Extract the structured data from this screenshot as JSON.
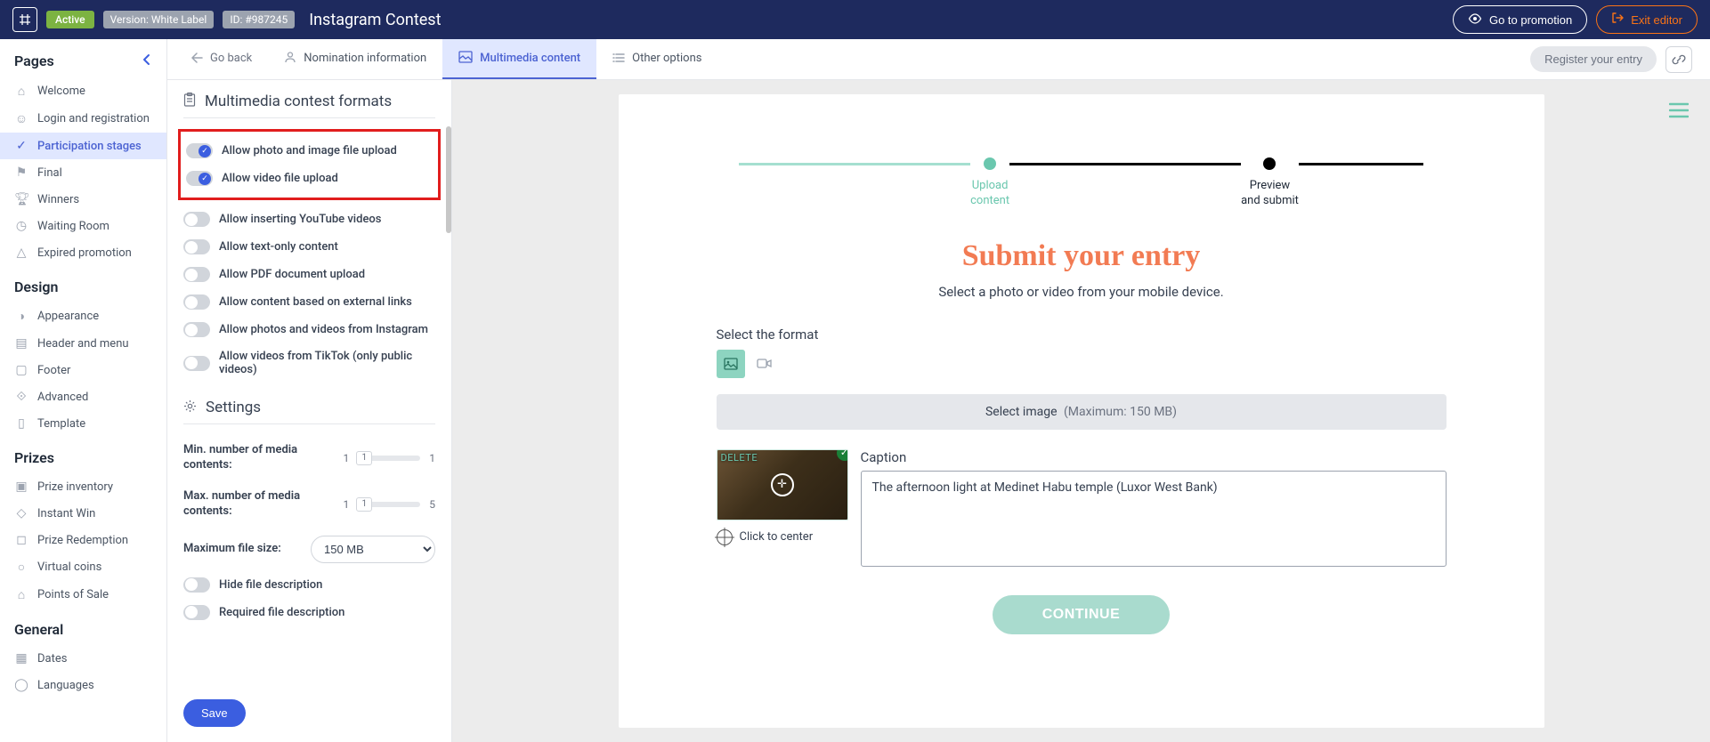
{
  "topbar": {
    "active_badge": "Active",
    "version_prefix": "Version: ",
    "version_value": "White Label",
    "id_prefix": "ID: ",
    "id_value": "#987245",
    "title": "Instagram Contest",
    "goto_label": "Go to promotion",
    "exit_label": "Exit editor"
  },
  "sidebar": {
    "pages_title": "Pages",
    "pages": [
      {
        "label": "Welcome"
      },
      {
        "label": "Login and registration"
      },
      {
        "label": "Participation stages"
      },
      {
        "label": "Final"
      },
      {
        "label": "Winners"
      },
      {
        "label": "Waiting Room"
      },
      {
        "label": "Expired promotion"
      }
    ],
    "design_title": "Design",
    "design": [
      {
        "label": "Appearance"
      },
      {
        "label": "Header and menu"
      },
      {
        "label": "Footer"
      },
      {
        "label": "Advanced"
      },
      {
        "label": "Template"
      }
    ],
    "prizes_title": "Prizes",
    "prizes": [
      {
        "label": "Prize inventory"
      },
      {
        "label": "Instant Win"
      },
      {
        "label": "Prize Redemption"
      },
      {
        "label": "Virtual coins"
      },
      {
        "label": "Points of Sale"
      }
    ],
    "general_title": "General",
    "general": [
      {
        "label": "Dates"
      },
      {
        "label": "Languages"
      }
    ]
  },
  "tabs": {
    "go_back": "Go back",
    "nomination": "Nomination information",
    "multimedia": "Multimedia content",
    "other": "Other options",
    "register": "Register your entry"
  },
  "panel": {
    "formats_heading": "Multimedia contest formats",
    "settings_heading": "Settings",
    "toggles": [
      {
        "label": "Allow photo and image file upload",
        "on": true
      },
      {
        "label": "Allow video file upload",
        "on": true
      },
      {
        "label": "Allow inserting YouTube videos",
        "on": false
      },
      {
        "label": "Allow text-only content",
        "on": false
      },
      {
        "label": "Allow PDF document upload",
        "on": false
      },
      {
        "label": "Allow content based on external links",
        "on": false
      },
      {
        "label": "Allow photos and videos from Instagram",
        "on": false
      },
      {
        "label": "Allow videos from TikTok (only public videos)",
        "on": false
      }
    ],
    "min_label": "Min. number of media contents:",
    "min_lo": "1",
    "min_val": "1",
    "min_hi": "1",
    "max_label": "Max. number of media contents:",
    "max_lo": "1",
    "max_val": "1",
    "max_hi": "5",
    "size_label": "Maximum file size:",
    "size_value": "150 MB",
    "hide_desc": "Hide file description",
    "req_desc": "Required file description",
    "save": "Save"
  },
  "preview": {
    "step_upload": "Upload content",
    "step_preview": "Preview and submit",
    "title": "Submit your entry",
    "subtitle": "Select a photo or video from your mobile device.",
    "format_label": "Select the format",
    "select_image": "Select image",
    "select_image_max": "(Maximum: 150 MB)",
    "delete": "DELETE",
    "click_center": "Click to center",
    "caption_label": "Caption",
    "caption_text": "The afternoon light at Medinet Habu temple (Luxor West Bank)",
    "continue": "CONTINUE"
  }
}
